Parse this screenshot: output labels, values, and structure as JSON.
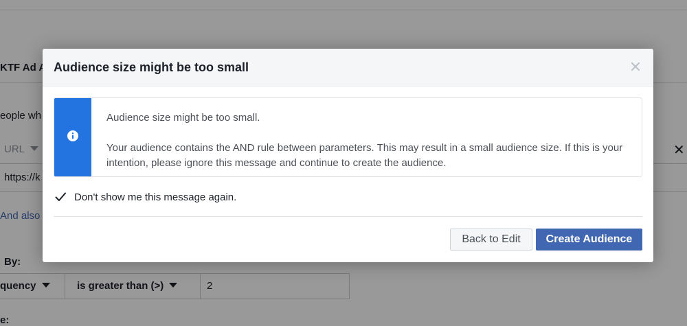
{
  "background": {
    "ad_account_fragment": "KTF Ad A",
    "people_fragment": "eople wh",
    "url_selector": "URL",
    "url_value_fragment": "https://k",
    "and_also_link": "And also",
    "by_label": "By:",
    "frequency_dropdown": "quency",
    "operator_dropdown": "is greater than (>)",
    "value_field": "2",
    "bottom_label_fragment": "e:"
  },
  "modal": {
    "title": "Audience size might be too small",
    "close_icon": "close-icon",
    "notice": {
      "icon": "info-icon",
      "accent_color": "#2374e1",
      "headline": "Audience size might be too small.",
      "body": "Your audience contains the AND rule between parameters. This may result in a small audience size. If this is your intention, please ignore this message and continue to create the audience."
    },
    "checkbox": {
      "checked": true,
      "label": "Don't show me this message again."
    },
    "buttons": {
      "back_label": "Back to Edit",
      "create_label": "Create Audience"
    },
    "primary_color": "#4267b2"
  }
}
